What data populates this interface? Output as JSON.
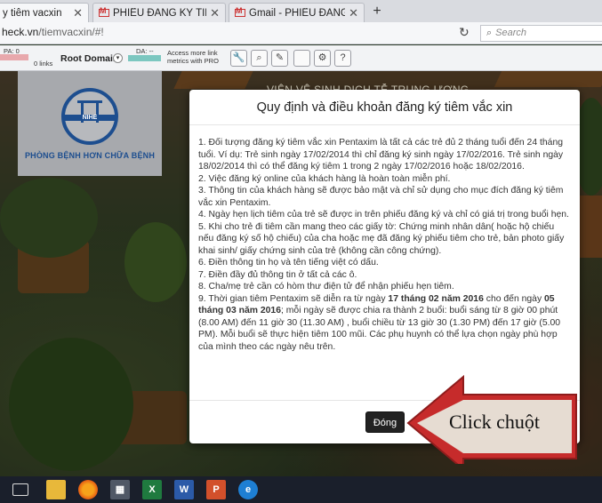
{
  "tabs": [
    {
      "title": "y tiêm vacxin",
      "active": true
    },
    {
      "title": "PHIẾU ĐĂNG KÝ TIÊM VA...",
      "active": false
    },
    {
      "title": "Gmail - PHIẾU ĐĂNG KÝ T...",
      "active": false
    }
  ],
  "address": {
    "host": "heck.vn",
    "path": "/tiemvacxin/#!",
    "search_placeholder": "Search"
  },
  "seo": {
    "pa": "PA: 0",
    "links": "0 links",
    "root_domain": "Root Domain:",
    "da": "DA: --",
    "access": "Access more link metrics with PRO"
  },
  "page": {
    "header": "VIỆN VỆ SINH DỊCH TỄ TRUNG ƯƠNG",
    "logo_abbr": "NIHE",
    "logo_slogan": "PHÒNG BỆNH HƠN CHỮA BỆNH"
  },
  "modal": {
    "title": "Quy định và điều khoản đăng ký tiêm vắc xin",
    "items": [
      "1. Đối tượng đăng ký tiêm vắc xin Pentaxim là tất cả các trẻ đủ 2 tháng tuổi đến 24 tháng tuổi. Ví dụ: Trẻ sinh ngày 17/02/2014 thì chỉ đăng ký sinh ngày 17/02/2016. Trẻ sinh ngày 18/02/2014 thì có thể đăng ký tiêm 1 trong 2 ngày 17/02/2016 hoặc 18/02/2016.",
      "2. Việc đăng ký online của khách hàng là hoàn toàn miễn phí.",
      "3. Thông tin của khách hàng sẽ được bảo mật và chỉ sử dụng cho mục đích đăng ký tiêm vắc xin Pentaxim.",
      "4. Ngày hẹn lịch tiêm của trẻ sẽ được in trên phiếu đăng ký và chỉ có giá trị trong buổi hẹn.",
      "5. Khi cho trẻ đi tiêm cần mang theo các giấy tờ: Chứng minh nhân dân( hoặc hộ chiếu nếu đăng ký số hộ chiếu) của cha hoặc mẹ đã đăng ký phiếu tiêm cho trẻ, bản photo giấy khai sinh/ giấy chứng sinh của trẻ (không cần công chứng).",
      "6. Điền thông tin họ và tên tiếng việt có dấu.",
      "7. Điền đầy đủ thông tin ở tất cả các ô.",
      "8. Cha/mẹ trẻ cần có hòm thư điện tử để nhận phiếu hẹn tiêm."
    ],
    "item9": {
      "a": "9. Thời gian tiêm Pentaxim sẽ diễn ra từ ngày ",
      "b": "17 tháng 02 năm 2016",
      "c": " cho đến ngày ",
      "d": "05 tháng 03 năm 2016",
      "e": "; mỗi ngày sẽ được chia ra thành 2 buổi: buổi sáng từ 8 giờ 00 phút (8.00 AM) đến 11 giờ 30 (11.30 AM) , buổi chiều từ 13 giờ 30 (1.30 PM) đến 17 giờ (5.00 PM). Mỗi buổi sẽ thực hiện tiêm 100 mũi. Các phụ huynh có thể lựa chọn ngày phù hợp của mình theo các ngày nêu trên."
    },
    "close_label": "Đóng"
  },
  "callout": {
    "text": "Click chuột",
    "color": "#c62b2b"
  },
  "taskbar": [
    "task-view-icon",
    "file-explorer-icon",
    "firefox-icon",
    "calculator-icon",
    "excel-icon",
    "word-icon",
    "powerpoint-icon",
    "edge-icon"
  ]
}
